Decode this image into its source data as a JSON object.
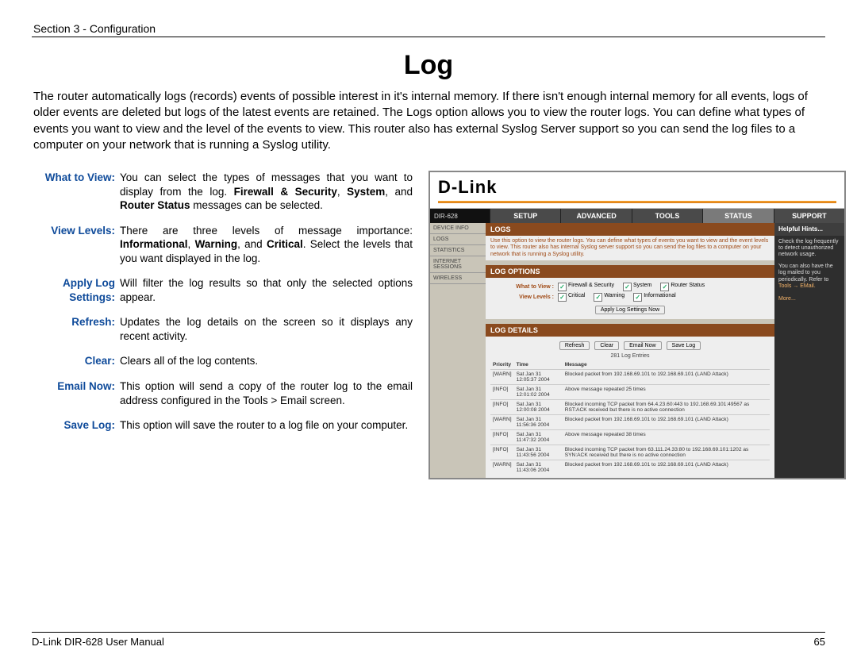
{
  "section_header": "Section 3 - Configuration",
  "title": "Log",
  "intro": "The router automatically logs (records) events of possible interest in it's internal memory. If there isn't enough internal memory for all events, logs of older events are deleted but logs of the latest events are retained. The Logs option allows you to view the router logs. You can define what types of events you want to view and the level of the events to view. This router also has external Syslog Server support so you can send the log files to a computer on your network that is running a Syslog utility.",
  "defs": [
    {
      "term": "What to View:",
      "desc_html": "You can select the types of messages that you want to display from the log. <b>Firewall & Security</b>, <b>System</b>, and <b>Router Status</b> messages can be selected."
    },
    {
      "term": "View Levels:",
      "desc_html": "There are three levels of message importance: <b>Informational</b>, <b>Warning</b>, and <b>Critical</b>. Select the levels that you want displayed in the log."
    },
    {
      "term": "Apply Log Settings:",
      "desc_html": "Will filter the log results so that only the selected options appear."
    },
    {
      "term": "Refresh:",
      "desc_html": "Updates the log details on the screen so it displays any recent activity."
    },
    {
      "term": "Clear:",
      "desc_html": "Clears all of the log contents."
    },
    {
      "term": "Email Now:",
      "desc_html": "This option will send a copy of the router log to the email address configured in the Tools > Email screen."
    },
    {
      "term": "Save Log:",
      "desc_html": "This option will save the router to a log file on your computer."
    }
  ],
  "shot": {
    "brand": "D-Link",
    "model": "DIR-628",
    "tabs": [
      "SETUP",
      "ADVANCED",
      "TOOLS",
      "STATUS",
      "SUPPORT"
    ],
    "active_tab": "STATUS",
    "side_items": [
      "DEVICE INFO",
      "LOGS",
      "STATISTICS",
      "INTERNET SESSIONS",
      "WIRELESS"
    ],
    "logs_head": "LOGS",
    "logs_desc": "Use this option to view the router logs. You can define what types of events you want to view and the event levels to view. This router also has internal Syslog server support so you can send the log files to a computer on your network that is running a Syslog utility.",
    "log_options_head": "LOG OPTIONS",
    "wtv_label": "What to View :",
    "wtv_opts": [
      "Firewall & Security",
      "System",
      "Router Status"
    ],
    "lvl_label": "View Levels :",
    "lvl_opts": [
      "Critical",
      "Warning",
      "Informational"
    ],
    "apply_btn": "Apply Log Settings Now",
    "log_details_head": "LOG DETAILS",
    "buttons": [
      "Refresh",
      "Clear",
      "Email Now",
      "Save Log"
    ],
    "count": "281 Log Entries",
    "cols": [
      "Priority",
      "Time",
      "Message"
    ],
    "rows": [
      {
        "p": "[WARN]",
        "t": "Sat Jan 31 12:05:37 2004",
        "m": "Blocked packet from 192.168.69.101 to 192.168.69.101 (LAND Attack)"
      },
      {
        "p": "[INFO]",
        "t": "Sat Jan 31 12:01:02 2004",
        "m": "Above message repeated 25 times"
      },
      {
        "p": "[INFO]",
        "t": "Sat Jan 31 12:00:08 2004",
        "m": "Blocked incoming TCP packet from 64.4.23.60:443 to 192.168.69.101:49567 as RST:ACK received but there is no active connection"
      },
      {
        "p": "[WARN]",
        "t": "Sat Jan 31 11:56:36 2004",
        "m": "Blocked packet from 192.168.69.101 to 192.168.69.101 (LAND Attack)"
      },
      {
        "p": "[INFO]",
        "t": "Sat Jan 31 11:47:32 2004",
        "m": "Above message repeated 38 times"
      },
      {
        "p": "[INFO]",
        "t": "Sat Jan 31 11:43:56 2004",
        "m": "Blocked incoming TCP packet from 63.111.24.33:80 to 192.168.69.101:1202 as SYN:ACK received but there is no active connection"
      },
      {
        "p": "[WARN]",
        "t": "Sat Jan 31 11:43:06 2004",
        "m": "Blocked packet from 192.168.69.101 to 192.168.69.101 (LAND Attack)"
      }
    ],
    "hints_head": "Helpful Hints...",
    "hints1": "Check the log frequently to detect unauthorized network usage.",
    "hints2": "You can also have the log mailed to you periodically. Refer to ",
    "hints_link": "Tools → EMail.",
    "hints_more": "More..."
  },
  "footer_left": "D-Link DIR-628 User Manual",
  "footer_right": "65"
}
